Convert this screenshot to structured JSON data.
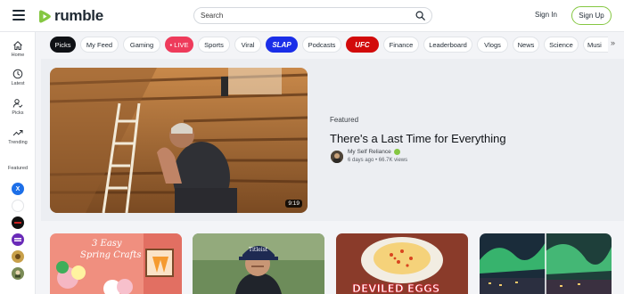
{
  "header": {
    "logo_text": "rumble",
    "search_placeholder": "Search",
    "sign_in": "Sign In",
    "sign_up": "Sign Up"
  },
  "sidebar": {
    "items": [
      {
        "label": "Home",
        "icon": "home-icon"
      },
      {
        "label": "Latest",
        "icon": "clock-icon"
      },
      {
        "label": "Picks",
        "icon": "user-check-icon"
      },
      {
        "label": "Trending",
        "icon": "trending-icon"
      }
    ],
    "featured_heading": "Featured",
    "channels": [
      {
        "name": "X",
        "color": "#1d6fe8"
      },
      {
        "name": "",
        "color": "#ffffff"
      },
      {
        "name": "",
        "color": "#111111"
      },
      {
        "name": "",
        "color": "#6a2bb8"
      },
      {
        "name": "",
        "color": "#c8a04a"
      },
      {
        "name": "",
        "color": "#7a8b56"
      }
    ]
  },
  "categories": [
    {
      "label": "Picks",
      "style": "active"
    },
    {
      "label": "My Feed",
      "style": ""
    },
    {
      "label": "Gaming",
      "style": ""
    },
    {
      "label": "• LIVE",
      "style": "live"
    },
    {
      "label": "Sports",
      "style": ""
    },
    {
      "label": "Viral",
      "style": ""
    },
    {
      "label": "SLAP",
      "style": "slap"
    },
    {
      "label": "Podcasts",
      "style": ""
    },
    {
      "label": "UFC",
      "style": "ufc"
    },
    {
      "label": "Finance",
      "style": ""
    },
    {
      "label": "Leaderboard",
      "style": ""
    },
    {
      "label": "Vlogs",
      "style": ""
    },
    {
      "label": "News",
      "style": ""
    },
    {
      "label": "Science",
      "style": ""
    },
    {
      "label": "Musi",
      "style": ""
    }
  ],
  "featured": {
    "kicker": "Featured",
    "title": "There's a Last Time for Everything",
    "channel": "My Self Reliance",
    "meta": "6 days ago • 66.7K views",
    "duration": "9:19"
  },
  "grid": [
    {
      "overlay": "3 Easy Spring Crafts"
    },
    {
      "overlay": ""
    },
    {
      "overlay": "DEVILED EGGS"
    },
    {
      "overlay": ""
    }
  ],
  "colors": {
    "brand_green": "#85c742",
    "live_red": "#ee3b5b"
  }
}
